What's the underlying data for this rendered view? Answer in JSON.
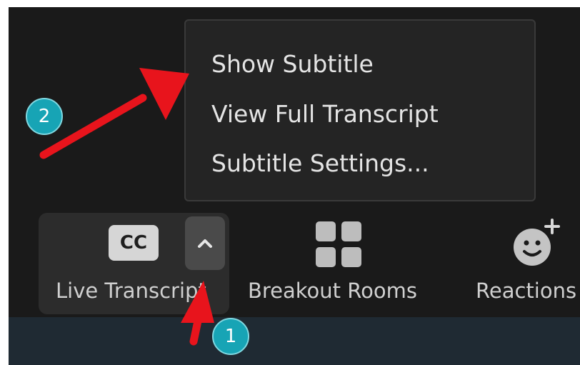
{
  "menu": {
    "items": [
      "Show Subtitle",
      "View Full Transcript",
      "Subtitle Settings..."
    ]
  },
  "toolbar": {
    "cc_label": "CC",
    "live_transcript_label": "Live Transcript",
    "breakout_label": "Breakout Rooms",
    "reactions_label": "Reactions"
  },
  "annotations": {
    "step1": "1",
    "step2": "2"
  },
  "colors": {
    "panel": "#1a1a1a",
    "menu": "#242424",
    "badge": "#17a4b5",
    "arrow": "#e8141c"
  }
}
